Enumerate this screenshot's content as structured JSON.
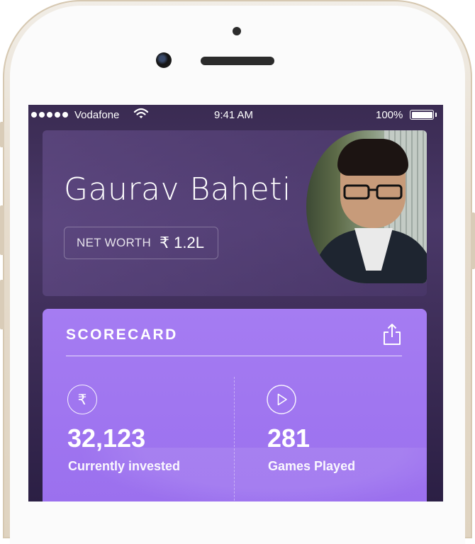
{
  "status_bar": {
    "carrier": "Vodafone",
    "time": "9:41 AM",
    "battery": "100%"
  },
  "profile": {
    "name": "Gaurav Baheti",
    "net_worth_label": "NET WORTH",
    "net_worth_value": "₹ 1.2L"
  },
  "scorecard": {
    "title": "SCORECARD",
    "stats": [
      {
        "icon": "rupee-icon",
        "value": "32,123",
        "label": "Currently invested"
      },
      {
        "icon": "play-icon",
        "value": "281",
        "label": "Games Played"
      }
    ]
  },
  "colors": {
    "background": "#3d2d57",
    "scorecard": "#a57cf2",
    "text": "#ffffff"
  }
}
